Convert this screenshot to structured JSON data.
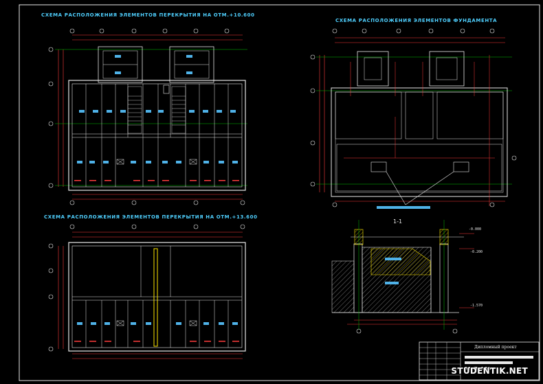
{
  "titles": {
    "floor_10": "СХЕМА РАСПОЛОЖЕНИЯ ЭЛЕМЕНТОВ ПЕРЕКРЫТИЯ НА ОТМ.+10.600",
    "foundation": "СХЕМА РАСПОЛОЖЕНИЯ ЭЛЕМЕНТОВ ФУНДАМЕНТА",
    "floor_13": "СХЕМА РАСПОЛОЖЕНИЯ ЭЛЕМЕНТОВ ПЕРЕКРЫТИЯ НА ОТМ.+13.600"
  },
  "section": {
    "label": "1-1",
    "elev_top": "-0.000",
    "elev_mid": "-0.200",
    "elev_bottom": "-1.570"
  },
  "stamp": {
    "project": "Дипломный проект"
  },
  "watermark": "STUDENTIK.NET",
  "colors": {
    "background": "#000000",
    "title": "#4fd0ff",
    "frame": "#e8e8e8",
    "dim": "#ff3b3b",
    "axis": "#00c000",
    "hatch": "#ffe900",
    "beam": "#ffe900"
  }
}
